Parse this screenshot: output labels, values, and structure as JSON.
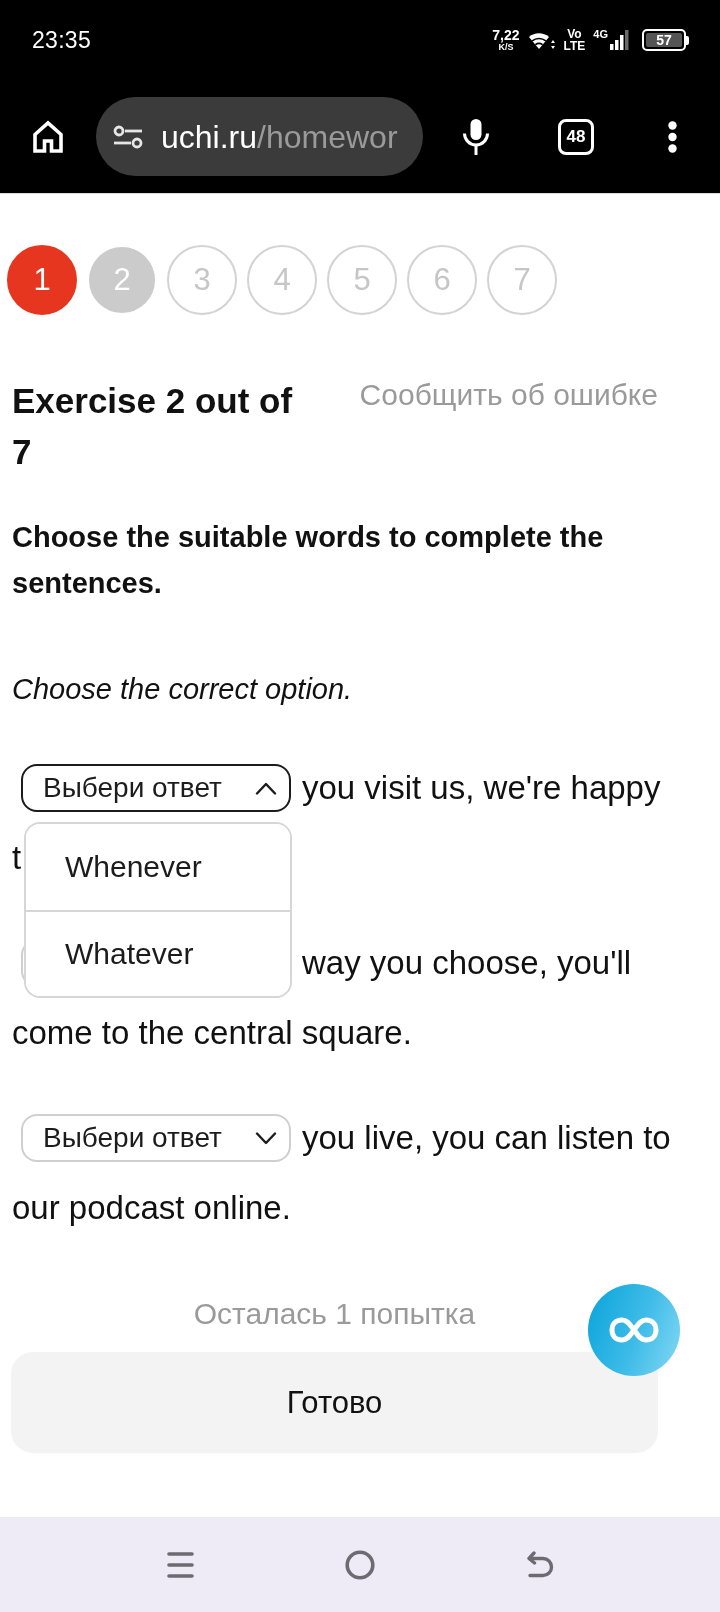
{
  "status_bar": {
    "time": "23:35",
    "net_speed": "7,22",
    "net_speed_unit": "K/S",
    "volte_top": "Vo",
    "volte_bottom": "LTE",
    "network": "4G",
    "battery": "57"
  },
  "browser": {
    "url_host": "uchi.ru",
    "url_path": "/homewor",
    "tab_count": "48"
  },
  "steps": [
    {
      "label": "1",
      "selected": false,
      "wrong": true
    },
    {
      "label": "2",
      "selected": true,
      "wrong": false
    },
    {
      "label": "3",
      "selected": false,
      "wrong": false
    },
    {
      "label": "4",
      "selected": false,
      "wrong": false
    },
    {
      "label": "5",
      "selected": false,
      "wrong": false
    },
    {
      "label": "6",
      "selected": false,
      "wrong": false
    },
    {
      "label": "7",
      "selected": false,
      "wrong": false
    }
  ],
  "exercise": {
    "title": "Exercise 2 out of 7",
    "report_link": "Сообщить об ошибке",
    "instruction": "Choose the suitable words to complete the sentences.",
    "hint": "Choose the correct option."
  },
  "sentences": [
    {
      "select": {
        "placeholder": "Выбери ответ",
        "expanded": true,
        "options": [
          {
            "label": "Whenever"
          },
          {
            "label": "Whatever"
          }
        ]
      },
      "text": "you visit us, we're happy",
      "continuation": "t"
    },
    {
      "select": {
        "expanded": false
      },
      "text": "way you choose, you'll",
      "continuation": "come to the central square."
    },
    {
      "select": {
        "placeholder": "Выбери ответ",
        "expanded": false
      },
      "text": "you live, you can listen to",
      "continuation": "our podcast online."
    }
  ],
  "attempts_left": "Осталась 1 попытка",
  "submit_button": "Готово"
}
